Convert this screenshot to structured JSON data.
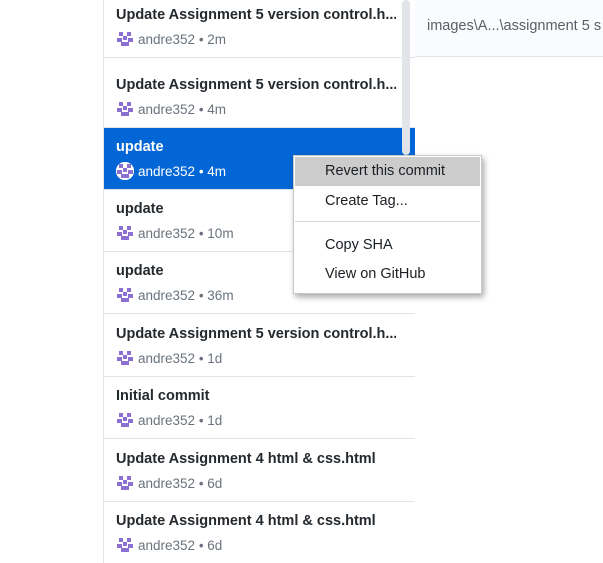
{
  "history": {
    "commits": [
      {
        "summary": "Update Assignment 5 version control.h...",
        "author": "andre352",
        "age": "2m"
      },
      {
        "summary": "Update Assignment 5 version control.h...",
        "author": "andre352",
        "age": "4m"
      },
      {
        "summary": "update",
        "author": "andre352",
        "age": "4m",
        "selected": true
      },
      {
        "summary": "update",
        "author": "andre352",
        "age": "10m"
      },
      {
        "summary": "update",
        "author": "andre352",
        "age": "36m"
      },
      {
        "summary": "Update Assignment 5 version control.h...",
        "author": "andre352",
        "age": "1d"
      },
      {
        "summary": "Initial commit",
        "author": "andre352",
        "age": "1d"
      },
      {
        "summary": "Update Assignment 4 html & css.html",
        "author": "andre352",
        "age": "6d"
      },
      {
        "summary": "Update Assignment 4 html & css.html",
        "author": "andre352",
        "age": "6d"
      }
    ]
  },
  "diff": {
    "file_path": "images\\A...\\assignment 5 s"
  },
  "context_menu": {
    "items": [
      {
        "label": "Revert this commit",
        "highlighted": true
      },
      {
        "label": "Create Tag..."
      },
      {
        "label": "Copy SHA"
      },
      {
        "label": "View on GitHub"
      }
    ]
  },
  "colors": {
    "selected_bg": "#0366d6",
    "avatar": "#8b6fd1",
    "menu_hover": "#cccccc"
  }
}
